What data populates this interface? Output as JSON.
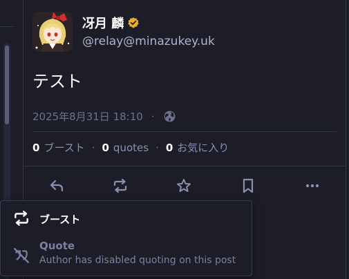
{
  "post": {
    "display_name": "冴月 麟",
    "handle": "@relay@minazukey.uk",
    "content": "テスト",
    "timestamp": "2025年8月31日 18:10",
    "meta_separator": "·",
    "visibility_icon": "globe-icon",
    "verified_icon": "verified-badge-icon"
  },
  "stats": {
    "boosts_count": "0",
    "boosts_label": "ブースト",
    "quotes_count": "0",
    "quotes_label": "quotes",
    "favourites_count": "0",
    "favourites_label": "お気に入り",
    "separator": "·"
  },
  "actions": {
    "reply_icon": "reply-icon",
    "boost_icon": "boost-icon",
    "favourite_icon": "star-icon",
    "bookmark_icon": "bookmark-icon",
    "more_icon": "more-horizontal-icon"
  },
  "boost_menu": {
    "boost_label": "ブースト",
    "quote_label": "Quote",
    "quote_disabled_text": "Author has disabled quoting on this post"
  },
  "colors": {
    "background": "#1c1d26",
    "verified_badge": "#e4b02e",
    "muted_text": "#6d7091",
    "handle_text": "#b0b3cf",
    "icon_color": "#8c8fb0"
  }
}
